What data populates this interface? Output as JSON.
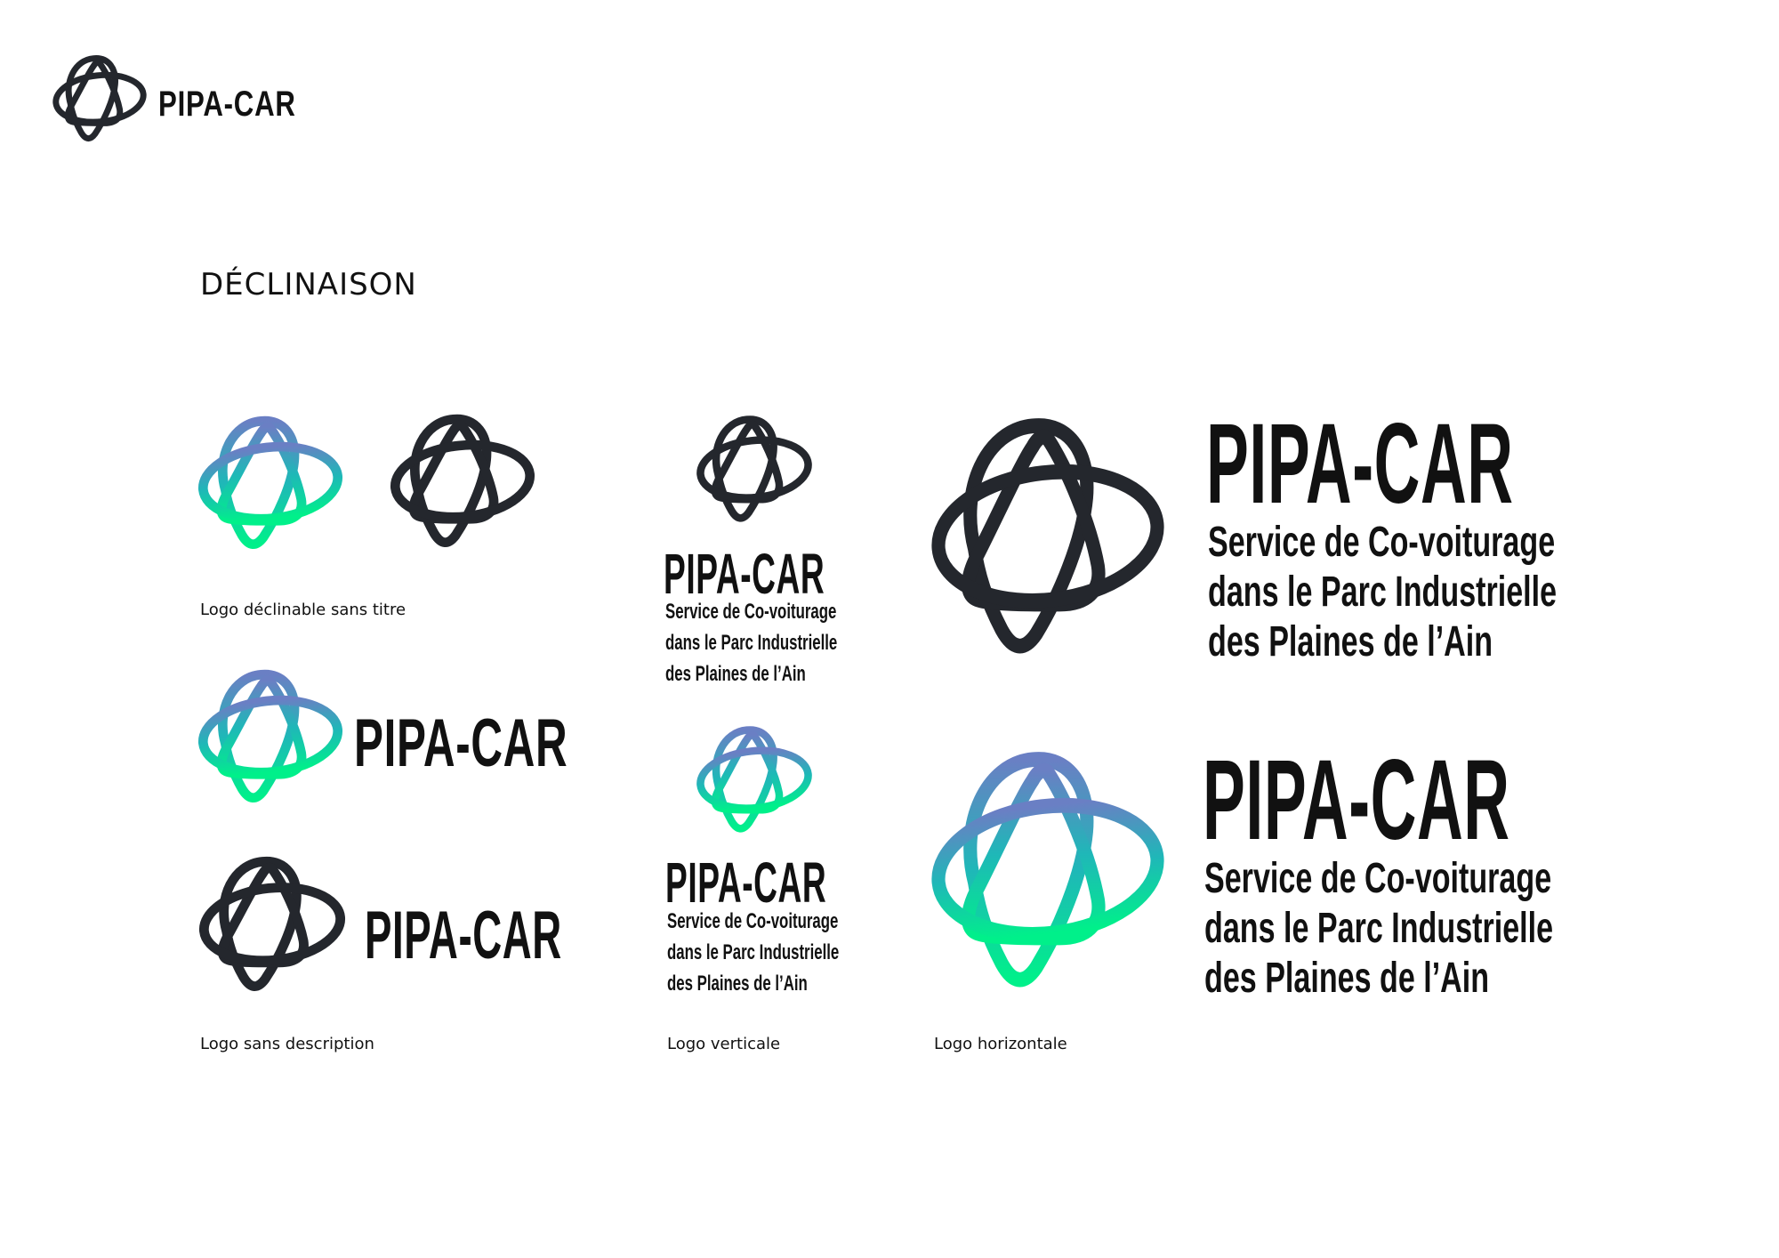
{
  "brand": {
    "name": "PIPA-CAR",
    "description_lines": [
      "Service de Co-voiturage",
      "dans le Parc Industrielle",
      "des Plaines de l’Ain"
    ]
  },
  "section_title": "DÉCLINAISON",
  "captions": {
    "sans_titre": "Logo déclinable sans titre",
    "sans_description": "Logo sans description",
    "verticale": "Logo verticale",
    "horizontale": "Logo horizontale"
  },
  "colors": {
    "dark": "#24272d",
    "gradient_top": "#6a7fc4",
    "gradient_mid": "#1fb7b8",
    "gradient_bottom": "#00f08a"
  }
}
